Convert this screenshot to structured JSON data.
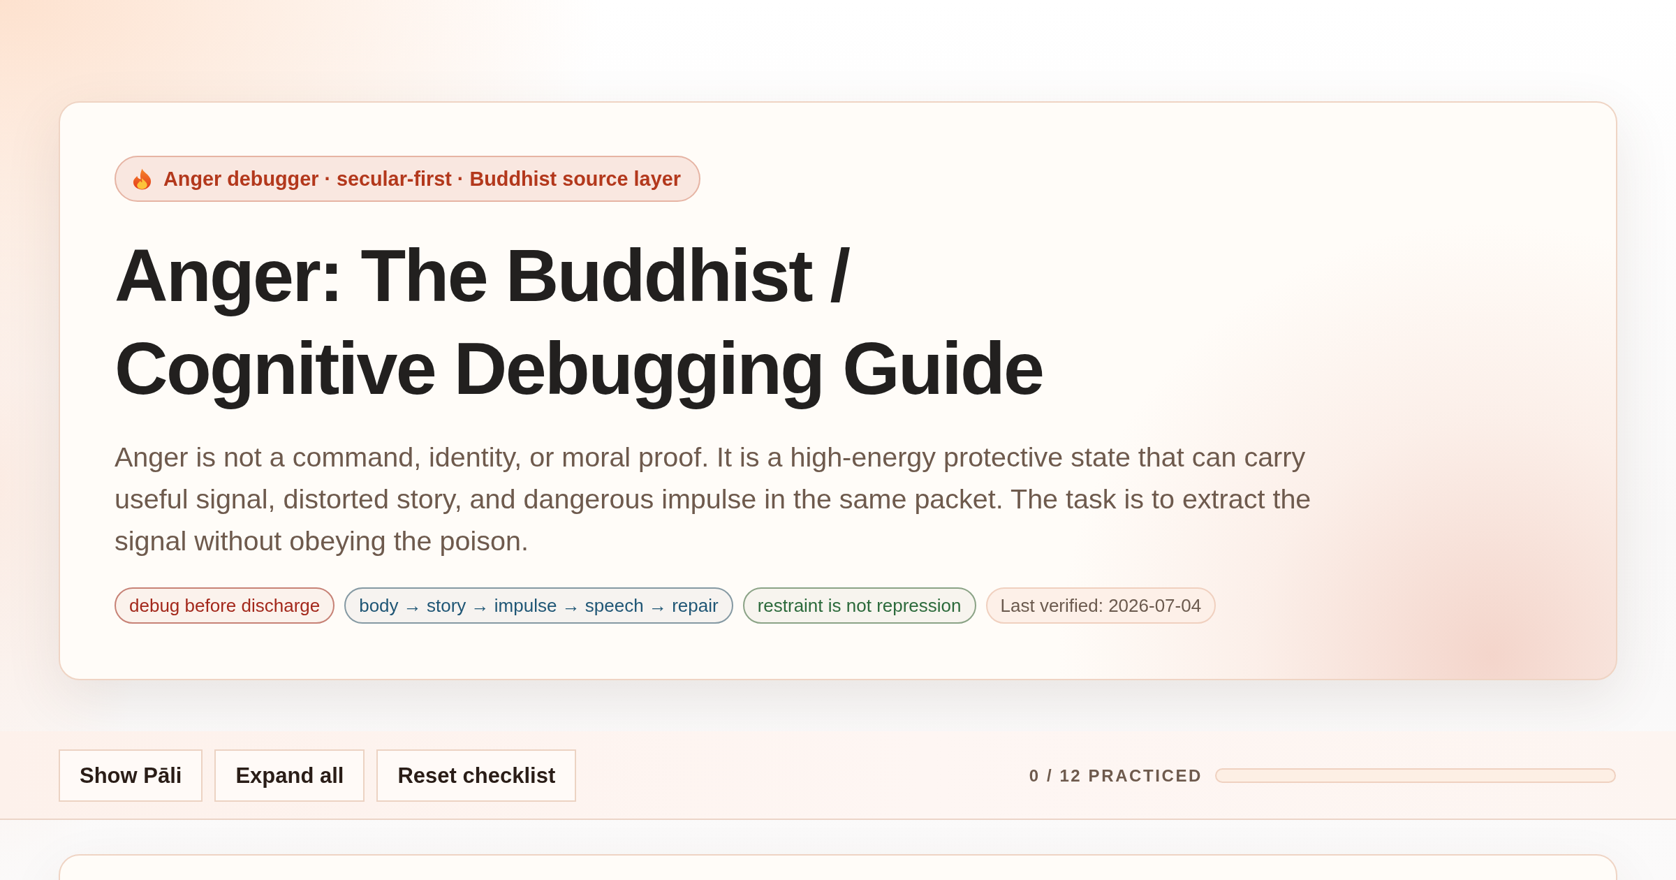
{
  "header": {
    "eyebrow": "Anger debugger · secular-first · Buddhist source layer",
    "title": "Anger: The Buddhist / Cognitive Debugging Guide",
    "summary": "Anger is not a command, identity, or moral proof. It is a high-energy protective state that can carry useful signal, distorted story, and dangerous impulse in the same packet. The task is to extract the signal without obeying the poison.",
    "tags": [
      {
        "text": "debug before discharge",
        "kind": "pill",
        "color": "#a3281b"
      },
      {
        "text": "body → story → impulse → speech → repair",
        "kind": "pill",
        "color": "#1f5675"
      },
      {
        "text": "restraint is not repression",
        "kind": "pill",
        "color": "#2c6a3b"
      },
      {
        "text": "Last verified: 2026-07-04",
        "kind": "meta",
        "color": "#6b5a4e"
      }
    ]
  },
  "toolbar": {
    "buttons": [
      "Show Pāli",
      "Expand all",
      "Reset checklist"
    ],
    "progress": {
      "label": "0 / 12 PRACTICED",
      "level": 0
    }
  }
}
